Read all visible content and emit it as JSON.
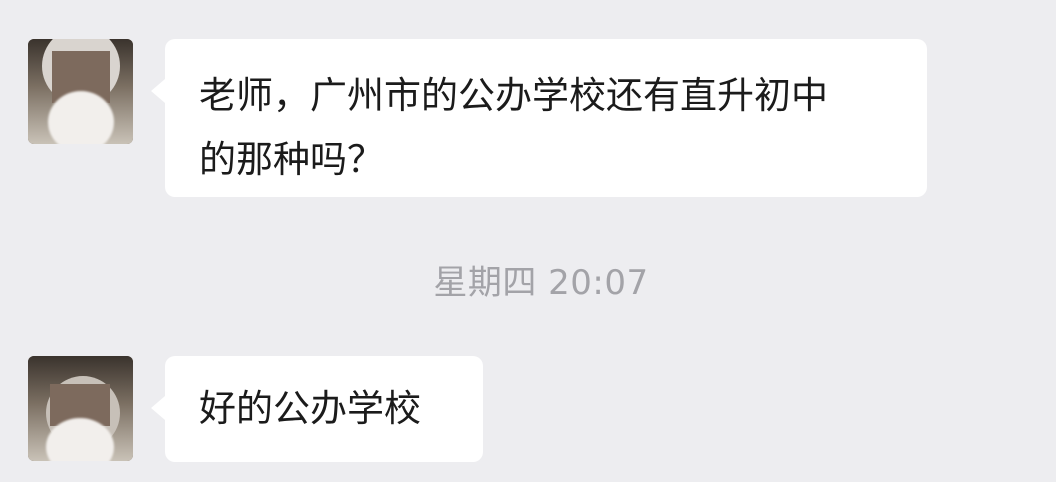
{
  "messages": [
    {
      "text_line1": "老师，广州市的公办学校还有直升初中",
      "text_line2": "的那种吗？"
    },
    {
      "text": "好的公办学校"
    }
  ],
  "timestamp": "星期四  20:07"
}
